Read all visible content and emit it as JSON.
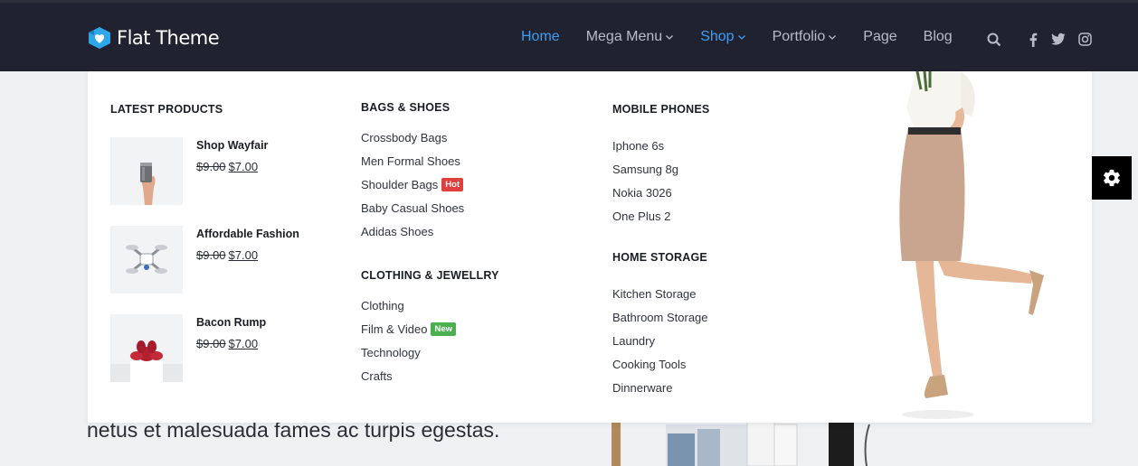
{
  "brand": {
    "name": "Flat Theme",
    "accent": "#3e9df5"
  },
  "nav": {
    "items": [
      {
        "label": "Home",
        "active": true,
        "dropdown": false
      },
      {
        "label": "Mega Menu",
        "active": false,
        "dropdown": true
      },
      {
        "label": "Shop",
        "active": true,
        "dropdown": true
      },
      {
        "label": "Portfolio",
        "active": false,
        "dropdown": true
      },
      {
        "label": "Page",
        "active": false,
        "dropdown": false
      },
      {
        "label": "Blog",
        "active": false,
        "dropdown": false
      }
    ],
    "icons": [
      "search-icon",
      "facebook-icon",
      "twitter-icon",
      "instagram-icon"
    ]
  },
  "mega": {
    "latest": {
      "title": "LATEST PRODUCTS",
      "products": [
        {
          "name": "Shop Wayfair",
          "old_price": "$9.00",
          "price": "$7.00"
        },
        {
          "name": "Affordable Fashion",
          "old_price": "$9.00",
          "price": "$7.00"
        },
        {
          "name": "Bacon Rump",
          "old_price": "$9.00",
          "price": "$7.00"
        }
      ]
    },
    "bags": {
      "title": "BAGS & SHOES",
      "links": [
        "Crossbody Bags",
        "Men Formal Shoes",
        "Shoulder Bags",
        "Baby Casual Shoes",
        "Adidas Shoes"
      ],
      "hot_badge": "Hot"
    },
    "clothing": {
      "title": "CLOTHING & JEWELLRY",
      "links": [
        "Clothing",
        "Film & Video",
        "Technology",
        "Crafts"
      ],
      "new_badge": "New"
    },
    "phones": {
      "title": "MOBILE PHONES",
      "links": [
        "Iphone 6s",
        "Samsung 8g",
        "Nokia 3026",
        "One Plus 2"
      ]
    },
    "storage": {
      "title": "HOME STORAGE",
      "links": [
        "Kitchen Storage",
        "Bathroom Storage",
        "Laundry",
        "Cooking Tools",
        "Dinnerware"
      ]
    }
  },
  "page": {
    "body_text": "netus et malesuada fames ac turpis egestas."
  },
  "colors": {
    "header_bg": "#20232f",
    "hot": "#e0403d",
    "new": "#4caf50",
    "nav_text": "#b9bcc6"
  }
}
